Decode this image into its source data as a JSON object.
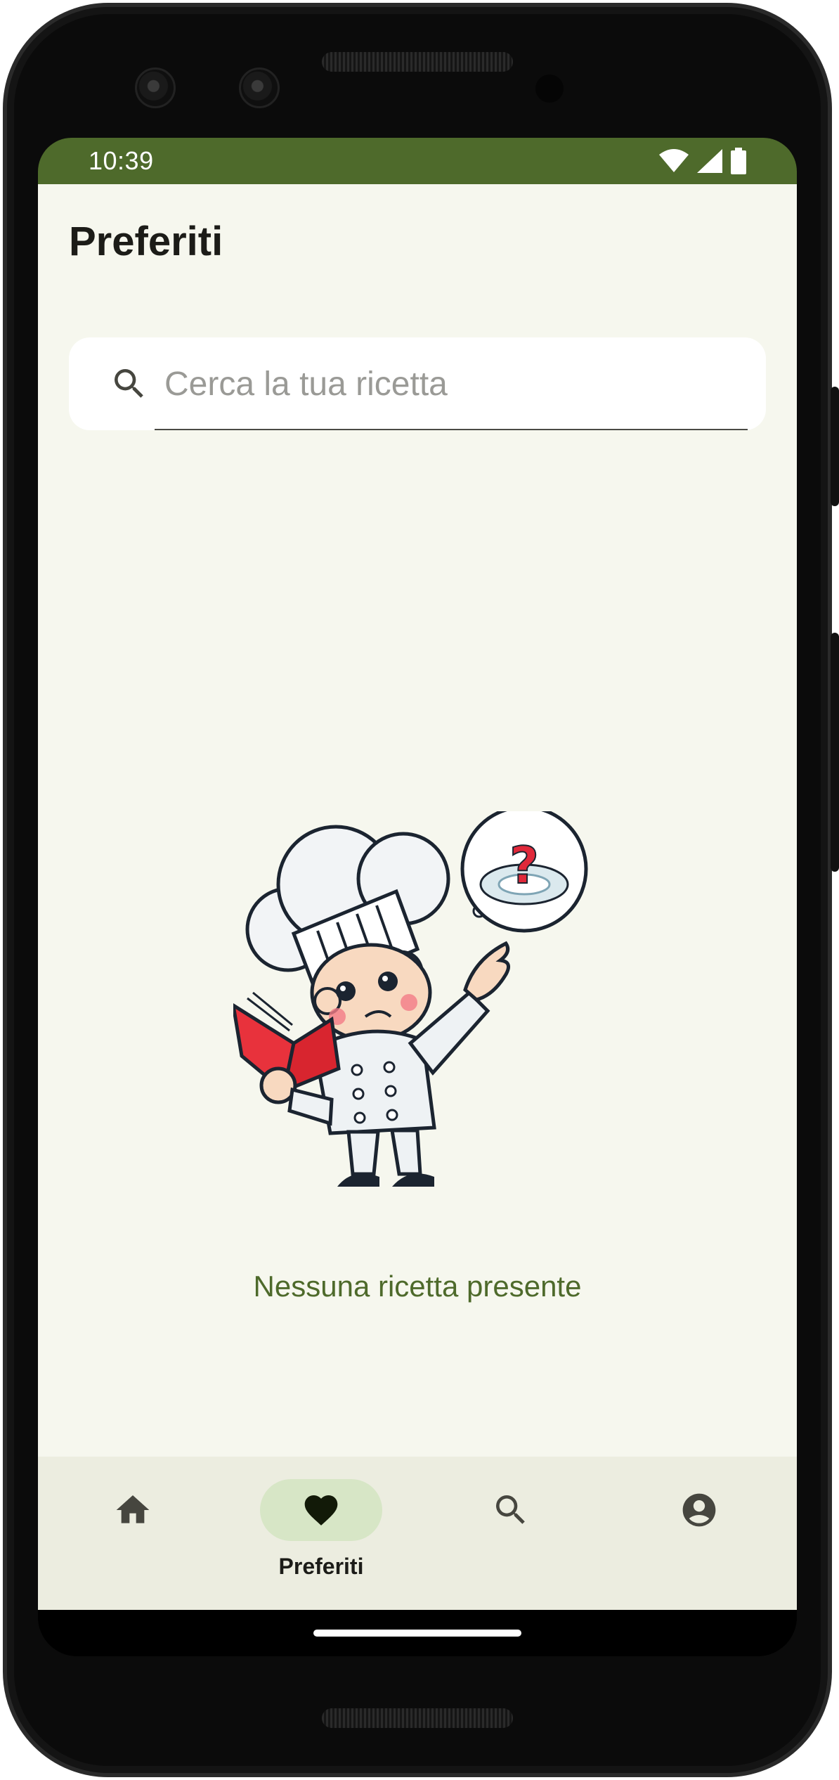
{
  "status_bar": {
    "time": "10:39",
    "icons": [
      "wifi-icon",
      "signal-icon",
      "battery-icon"
    ],
    "background": "#4e6a2b"
  },
  "header": {
    "title": "Preferiti"
  },
  "search": {
    "placeholder": "Cerca la tua ricetta",
    "value": "",
    "icon": "search-icon"
  },
  "empty_state": {
    "illustration": "confused-chef-illustration",
    "message": "Nessuna ricetta presente"
  },
  "bottom_nav": {
    "items": [
      {
        "id": "home",
        "icon": "home-icon",
        "label": "",
        "selected": false
      },
      {
        "id": "favorites",
        "icon": "heart-icon",
        "label": "Preferiti",
        "selected": true
      },
      {
        "id": "search",
        "icon": "search-icon",
        "label": "",
        "selected": false
      },
      {
        "id": "profile",
        "icon": "account-circle-icon",
        "label": "",
        "selected": false
      }
    ]
  },
  "colors": {
    "accent": "#4e6a2b",
    "background": "#f6f7ee",
    "nav_background": "#ecede0",
    "selected_pill": "#d7e6c6"
  }
}
